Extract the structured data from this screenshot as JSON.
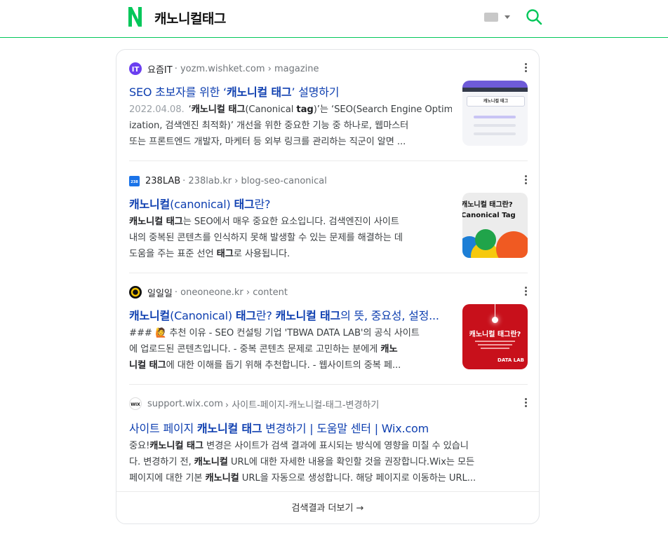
{
  "header": {
    "query": "캐노니컬태그"
  },
  "results": [
    {
      "site_name": "요즘IT",
      "site_url": "· yozm.wishket.com › magazine",
      "title": [
        "SEO 초보자를 위한 ‘",
        "캐노니컬 태그",
        "’ 설명하기"
      ],
      "date": "2022.04.08.",
      "snippet_lines": [
        [
          "‘",
          "캐노니컬 태그",
          "(Canonical ",
          "tag",
          ")’는 ‘SEO(Search Engine Optim"
        ],
        [
          "ization, 검색엔진 최적화)’ 개선을 위한 중요한 기능 중 하나로, 웹마스터"
        ],
        [
          "또는 프론트엔드 개발자, 마케터 등 외부 링크를 관리하는 직군이 알면 ..."
        ]
      ],
      "thumb_text": "캐노니컬 태그"
    },
    {
      "site_name": "238LAB",
      "site_url": "· 238lab.kr › blog-seo-canonical",
      "title": [
        "",
        "캐노니컬",
        "(canonical) ",
        "태그",
        "란?"
      ],
      "snippet_lines": [
        [
          "",
          "캐노니컬 태그",
          "는 SEO에서 매우 중요한 요소입니다. 검색엔진이 사이트"
        ],
        [
          "내의 중복된 콘텐츠를 인식하지 못해 발생할 수 있는 문제를 해결하는 데"
        ],
        [
          "도움을 주는 표준 선언 ",
          "태그",
          "로 사용됩니다."
        ]
      ],
      "thumb_line1": "캐노니컬 태그란?",
      "thumb_line2": "Canonical Tag"
    },
    {
      "site_name": "일일일",
      "site_url": "· oneoneone.kr › content",
      "title": [
        "",
        "캐노니컬",
        "(Canonical) ",
        "태그",
        "란? ",
        "캐노니컬 태그",
        "의 뜻, 중요성, 설정..."
      ],
      "snippet_lines": [
        [
          "### 🙋 추천 이유 - SEO 컨설팅 기업 'TBWA DATA LAB'의 공식 사이트"
        ],
        [
          "에 업로드된 콘텐츠입니다. - 중복 콘텐츠 문제로 고민하는 분에게 ",
          "캐노"
        ],
        [
          "니컬 태그",
          "에 대한 이해를 돕기 위해 추천합니다. - 웹사이트의 중복 페..."
        ]
      ],
      "thumb_title": "캐노니컬 태그란?",
      "thumb_brand": "DATA LAB"
    },
    {
      "site_name": "support.wix.com",
      "site_url": "› 사이트-페이지-캐노니컬-태그-변경하기",
      "title": [
        "사이트 페이지 ",
        "캐노니컬 태그",
        " 변경하기 | 도움말 센터 | Wix.com"
      ],
      "snippet_lines": [
        [
          "중요!",
          "캐노니컬 태그",
          " 변경은 사이트가 검색 결과에 표시되는 방식에 영향을 미칠 수 있습니"
        ],
        [
          "다. 변경하기 전, ",
          "캐노니컬",
          " URL에 대한 자세한 내용을 확인할 것을 권장합니다.Wix는 모든"
        ],
        [
          "페이지에 대한 기본 ",
          "캐노니컬",
          " URL을 자동으로 생성합니다. 해당 페이지로 이동하는 URL..."
        ]
      ]
    }
  ],
  "footer": {
    "more_label": "검색결과 더보기 →"
  },
  "colors": {
    "brand": "#03c75a",
    "link": "#0e3fb0"
  }
}
